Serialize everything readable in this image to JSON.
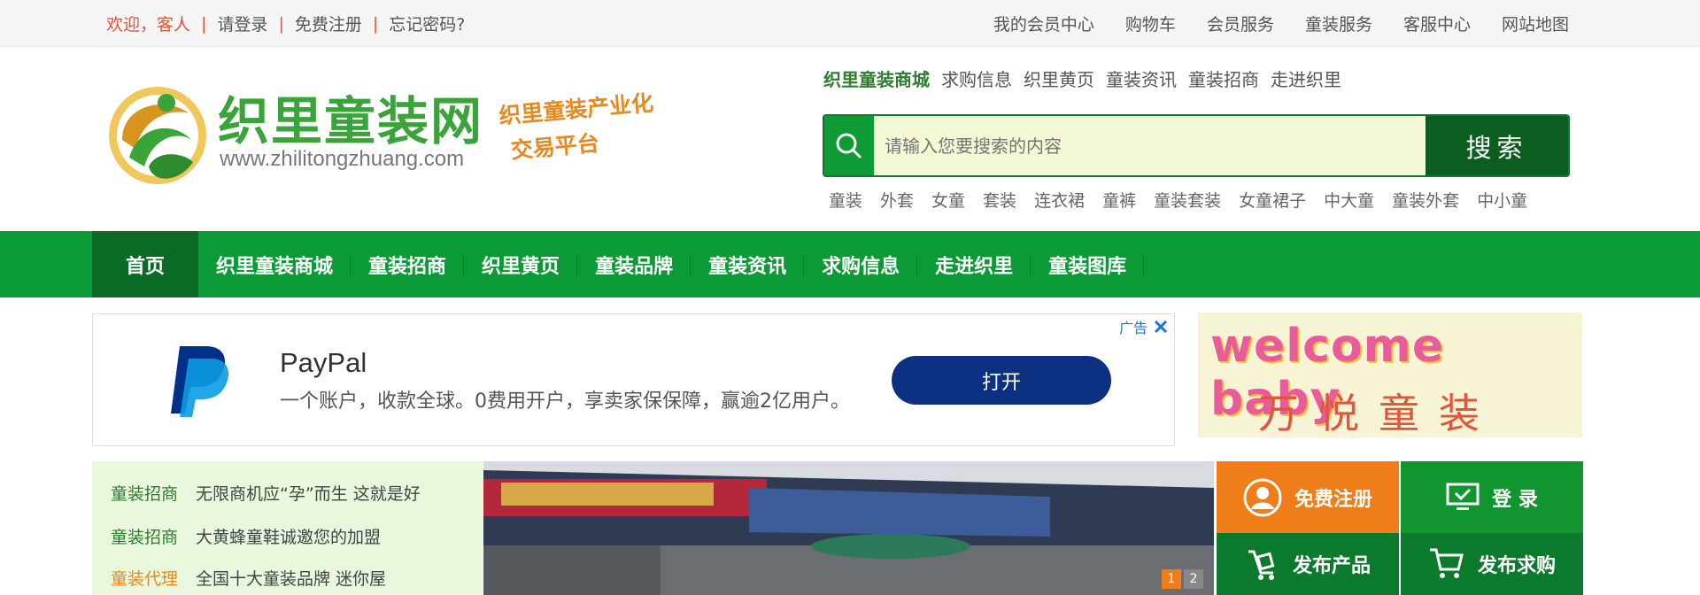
{
  "topbar": {
    "welcome": "欢迎，客人",
    "login": "请登录",
    "register": "免费注册",
    "forgot": "忘记密码?",
    "right_links": [
      "我的会员中心",
      "购物车",
      "会员服务",
      "童装服务",
      "客服中心",
      "网站地图"
    ]
  },
  "logo": {
    "title": "织里童装网",
    "url": "www.zhilitongzhuang.com",
    "slogan_line1": "织里童装产业化",
    "slogan_line2": "交易平台"
  },
  "quicklinks": [
    "织里童装商城",
    "求购信息",
    "织里黄页",
    "童装资讯",
    "童装招商",
    "走进织里"
  ],
  "search": {
    "placeholder": "请输入您要搜索的内容",
    "button": "搜索"
  },
  "hotwords": [
    "童装",
    "外套",
    "女童",
    "套装",
    "连衣裙",
    "童裤",
    "童装套装",
    "女童裙子",
    "中大童",
    "童装外套",
    "中小童"
  ],
  "nav": [
    "首页",
    "织里童装商城",
    "童装招商",
    "织里黄页",
    "童装品牌",
    "童装资讯",
    "求购信息",
    "走进织里",
    "童装图库"
  ],
  "ad": {
    "label": "广告",
    "title": "PayPal",
    "desc": "一个账户，收款全球。0费用开户，享卖家保保障，赢逾2亿用户。",
    "button": "打开"
  },
  "banner": {
    "welcome_text": "welcome baby",
    "brand": "万悦童装"
  },
  "news": [
    {
      "cat": "童装招商",
      "text": "无限商机应“孕”而生 这就是好"
    },
    {
      "cat": "童装招商",
      "text": "大黄蜂童鞋诚邀您的加盟"
    },
    {
      "cat": "童装代理",
      "text": "全国十大童装品牌 迷你屋"
    }
  ],
  "slider": {
    "pages": [
      "1",
      "2"
    ]
  },
  "actions": {
    "register": "免费注册",
    "login": "登 录",
    "publish_product": "发布产品",
    "publish_request": "发布求购"
  },
  "colors": {
    "primary_green": "#0c9a36",
    "dark_green": "#0b5e1f",
    "orange": "#ee7d1a",
    "red_text": "#e0553b",
    "paypal_blue": "#0c3182"
  }
}
